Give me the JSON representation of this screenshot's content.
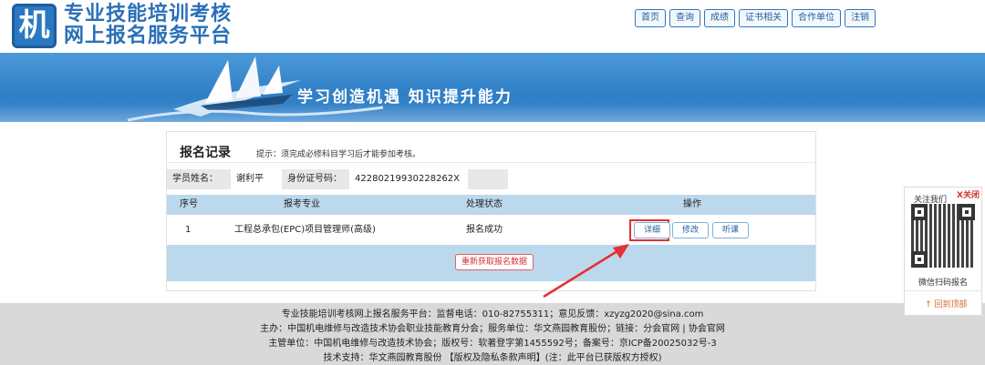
{
  "header": {
    "logo_char": "机",
    "title_line1": "专业技能培训考核",
    "title_line2": "网上报名服务平台"
  },
  "nav": [
    "首页",
    "查询",
    "成绩",
    "证书相关",
    "合作单位",
    "注销"
  ],
  "banner": {
    "slogan": "学习创造机遇  知识提升能力"
  },
  "card": {
    "title": "报名记录",
    "hint": "提示：须完成必修科目学习后才能参加考核。"
  },
  "student": {
    "name_label": "学员姓名：",
    "name": "谢利平",
    "id_label": "身份证号码：",
    "id": "42280219930228262X"
  },
  "table": {
    "headers": [
      "序号",
      "报考专业",
      "处理状态",
      "操作"
    ],
    "rows": [
      {
        "no": "1",
        "major": "工程总承包(EPC)项目管理师(高级)",
        "status": "报名成功"
      }
    ],
    "actions": [
      "详细",
      "修改",
      "听课"
    ],
    "refresh_label": "重新获取报名数据"
  },
  "footer": {
    "line1": "专业技能培训考核网上报名服务平台：监督电话：010-82755311；意见反馈：xzyzg2020@sina.com",
    "line2": "主办：中国机电维修与改造技术协会职业技能教育分会；服务单位：华文燕园教育股份；链接：分会官网 | 协会官网",
    "line3": "主管单位：中国机电维修与改造技术协会；版权号：软著登字第1455592号；备案号：京ICP备20025032号-3",
    "line4": "技术支持：华文燕园教育股份 【版权及隐私条款声明】(注：此平台已获版权方授权)"
  },
  "qr_panel": {
    "title": "关注我们",
    "close": "X关闭",
    "caption": "微信扫码报名",
    "back_top": "回到顶部"
  },
  "colors": {
    "brand_blue": "#2a78c2",
    "table_blue": "#bcd8ec",
    "highlight_red": "#e53030"
  }
}
